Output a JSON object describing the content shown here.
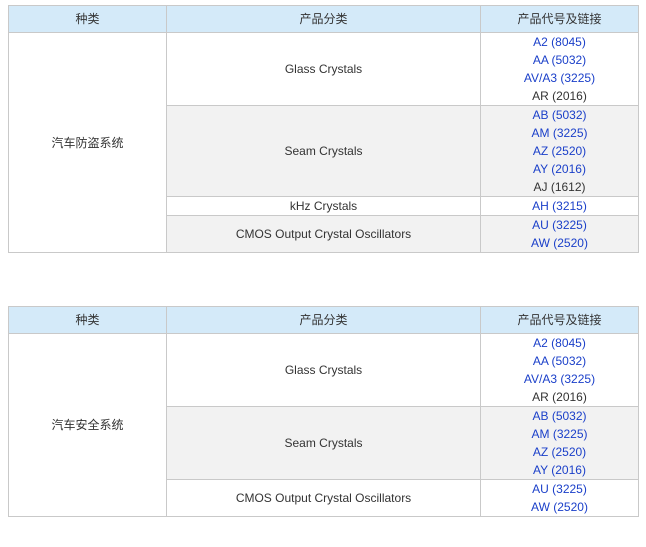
{
  "headers": {
    "category": "种类",
    "product": "产品分类",
    "code": "产品代号及链接"
  },
  "colors": {
    "header_bg": "#d4eaf9",
    "link": "#1a3fc9",
    "text": "#333333",
    "border": "#c9c9c9",
    "alt_row": "#f2f2f2"
  },
  "tables": [
    {
      "category": "汽车防盗系统",
      "rows": [
        {
          "product": "Glass Crystals",
          "codes": [
            {
              "text": "A2 (8045)",
              "link": true
            },
            {
              "text": "AA (5032)",
              "link": true
            },
            {
              "text": "AV/A3 (3225)",
              "link": true
            },
            {
              "text": "AR (2016)",
              "link": false
            }
          ]
        },
        {
          "product": "Seam Crystals",
          "codes": [
            {
              "text": "AB (5032)",
              "link": true
            },
            {
              "text": "AM (3225)",
              "link": true
            },
            {
              "text": "AZ (2520)",
              "link": true
            },
            {
              "text": "AY (2016)",
              "link": true
            },
            {
              "text": "AJ (1612)",
              "link": false
            }
          ]
        },
        {
          "product": "kHz Crystals",
          "codes": [
            {
              "text": "AH (3215)",
              "link": true
            }
          ]
        },
        {
          "product": "CMOS Output Crystal Oscillators",
          "codes": [
            {
              "text": "AU (3225)",
              "link": true
            },
            {
              "text": "AW (2520)",
              "link": true
            }
          ]
        }
      ]
    },
    {
      "category": "汽车安全系统",
      "rows": [
        {
          "product": "Glass Crystals",
          "codes": [
            {
              "text": "A2 (8045)",
              "link": true
            },
            {
              "text": "AA (5032)",
              "link": true
            },
            {
              "text": "AV/A3 (3225)",
              "link": true
            },
            {
              "text": "AR (2016)",
              "link": false
            }
          ]
        },
        {
          "product": "Seam Crystals",
          "codes": [
            {
              "text": "AB (5032)",
              "link": true
            },
            {
              "text": "AM (3225)",
              "link": true
            },
            {
              "text": "AZ (2520)",
              "link": true
            },
            {
              "text": "AY (2016)",
              "link": true
            }
          ]
        },
        {
          "product": "CMOS Output Crystal Oscillators",
          "codes": [
            {
              "text": "AU (3225)",
              "link": true
            },
            {
              "text": "AW (2520)",
              "link": true
            }
          ]
        }
      ]
    }
  ]
}
